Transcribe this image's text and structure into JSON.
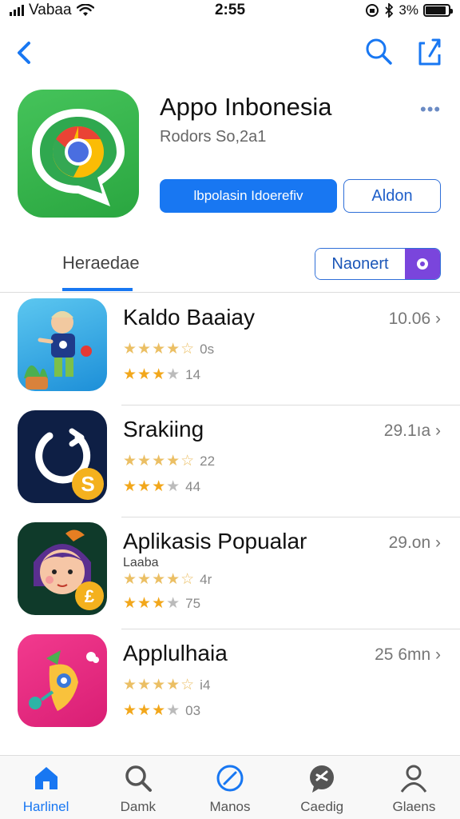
{
  "status_bar": {
    "carrier": "Vabaa",
    "time": "2:55",
    "battery_percent": "3%",
    "battery_level": 0.9
  },
  "nav": {
    "back_icon": "chevron-left-icon",
    "search_icon": "search-icon",
    "share_icon": "share-icon"
  },
  "app": {
    "title": "Appo Inbonesia",
    "subtitle": "Rodors So,2a1",
    "primary_button": "lbpolasin Idoerefiv",
    "secondary_button": "Aldon"
  },
  "tabs": {
    "active_label": "Heraedae",
    "pill_label": "Naonert"
  },
  "list": [
    {
      "title": "Kaldo Baaiay",
      "meta": "10.06",
      "rating1_value": "0s",
      "rating2_value": "14",
      "caption": ""
    },
    {
      "title": "Srakiing",
      "meta": "29.1ıa",
      "rating1_value": "22",
      "rating2_value": "44",
      "caption": ""
    },
    {
      "title": "Aplikasis Popualar",
      "meta": "29.on",
      "rating1_value": "4r",
      "rating2_value": "75",
      "caption": "Laaba"
    },
    {
      "title": "Applulhaia",
      "meta": "25 6mn",
      "rating1_value": "i4",
      "rating2_value": "03",
      "caption": ""
    }
  ],
  "tab_bar": [
    {
      "label": "Harlinel",
      "icon": "home-icon",
      "active": true
    },
    {
      "label": "Damk",
      "icon": "search-icon",
      "active": false
    },
    {
      "label": "Manos",
      "icon": "compass-icon",
      "active": false
    },
    {
      "label": "Caedig",
      "icon": "chat-icon",
      "active": false
    },
    {
      "label": "Glaens",
      "icon": "profile-icon",
      "active": false
    }
  ],
  "colors": {
    "accent": "#1877f2",
    "star": "#f2a71b",
    "app_icon_green": "#2aa640",
    "pill_purple": "#7a45dc"
  }
}
